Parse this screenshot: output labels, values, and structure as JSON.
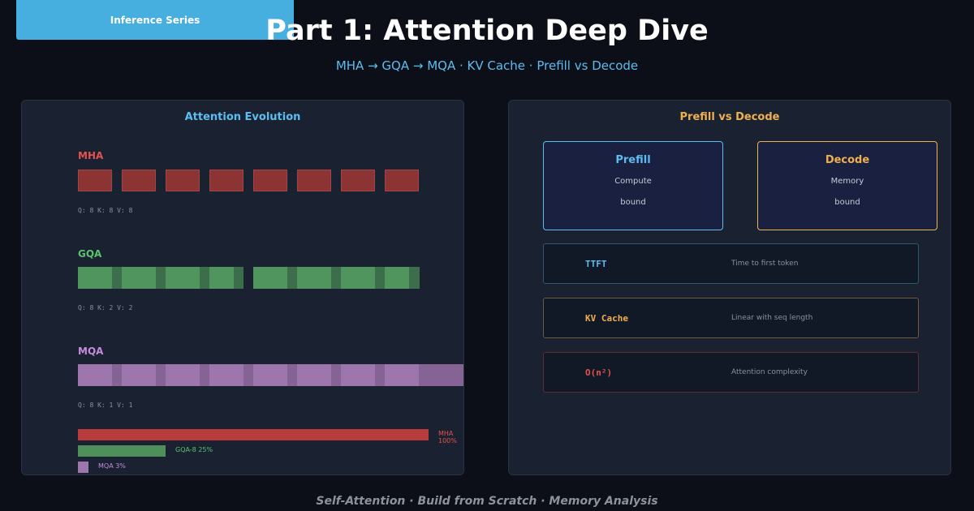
{
  "header": {
    "badge": "Inference Series",
    "title": "Part 1: Attention Deep Dive",
    "subtitle": "MHA → GQA → MQA  ·  KV Cache  ·  Prefill vs Decode"
  },
  "left_panel": {
    "title": "Attention Evolution",
    "variants": [
      {
        "name": "MHA",
        "stats": "Q: 8  K: 8  V: 8",
        "color": "#e55050"
      },
      {
        "name": "GQA",
        "stats": "Q: 8  K: 2  V: 2",
        "color": "#5cc26e"
      },
      {
        "name": "MQA",
        "stats": "Q: 8  K: 1  V: 1",
        "color": "#c68ae0"
      }
    ],
    "memory": [
      {
        "label": "MHA 100%",
        "percent": 100,
        "color": "#b83c3c",
        "text_color": "#e55050"
      },
      {
        "label": "GQA-8 25%",
        "percent": 25,
        "color": "#4f8f5a",
        "text_color": "#5cc26e"
      },
      {
        "label": "MQA 3%",
        "percent": 3,
        "color": "#9e76ae",
        "text_color": "#c68ae0"
      }
    ]
  },
  "right_panel": {
    "title": "Prefill vs Decode",
    "prefill": {
      "name": "Prefill",
      "line1": "Compute",
      "line2": "bound",
      "color": "#5bbef0"
    },
    "decode": {
      "name": "Decode",
      "line1": "Memory",
      "line2": "bound",
      "color": "#f0b050"
    },
    "metrics": [
      {
        "key": "TTFT",
        "desc": "Time to first token",
        "color": "#5bbef0",
        "border": "#2c5a73"
      },
      {
        "key": "KV Cache",
        "desc": "Linear with seq length",
        "color": "#f0b050",
        "border": "#6e5a3a"
      },
      {
        "key": "O(n²)",
        "desc": "Attention complexity",
        "color": "#e55050",
        "border": "#5a2e33"
      }
    ]
  },
  "footer": "Self-Attention  ·  Build from Scratch  ·  Memory Analysis"
}
